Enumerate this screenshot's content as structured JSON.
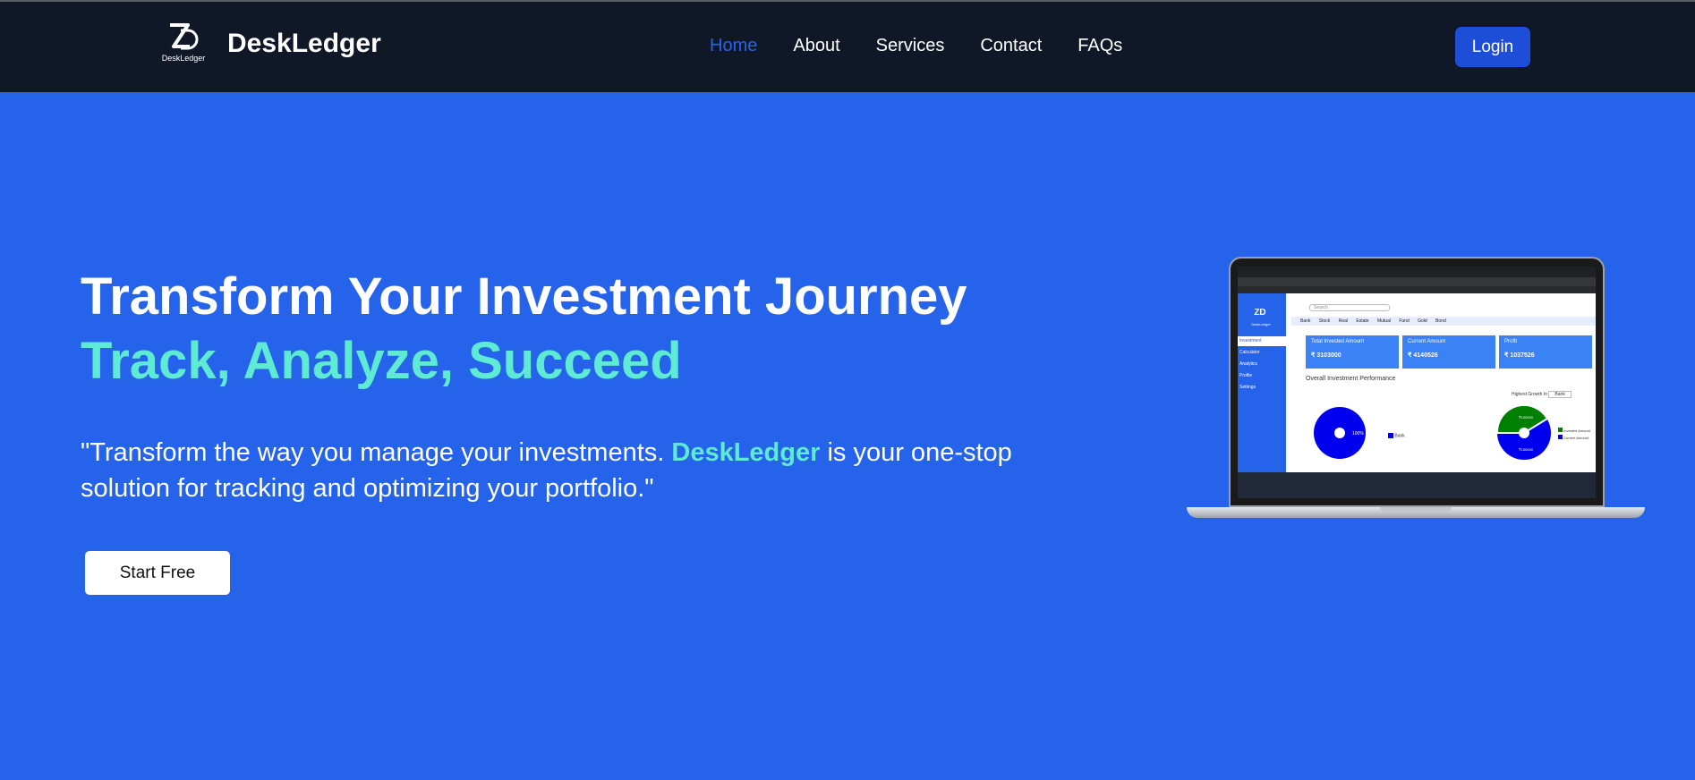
{
  "brand": {
    "name": "DeskLedger",
    "logo_caption": "DeskLedger",
    "logo_icon": "zd-monogram-icon"
  },
  "nav": {
    "items": [
      {
        "label": "Home",
        "active": true
      },
      {
        "label": "About",
        "active": false
      },
      {
        "label": "Services",
        "active": false
      },
      {
        "label": "Contact",
        "active": false
      },
      {
        "label": "FAQs",
        "active": false
      }
    ],
    "login_label": "Login"
  },
  "hero": {
    "title_line1": "Transform Your Investment Journey",
    "title_line2": "Track, Analyze, Succeed",
    "desc_before": "\"Transform the way you manage your investments. ",
    "desc_accent": "DeskLedger",
    "desc_after": " is your one-stop solution for tracking and optimizing your portfolio.\"",
    "cta_label": "Start Free"
  },
  "laptop_screen": {
    "logo_caption": "DeskLedger",
    "search_placeholder": "Search",
    "menu_items": [
      "Bank",
      "Stock",
      "Real Estate",
      "Mutual Fund",
      "Gold",
      "Bond"
    ],
    "sidebar_items": [
      "Investment",
      "Calculator",
      "Analytics",
      "Profile",
      "Settings"
    ],
    "cards": [
      {
        "label": "Total Invested Amount",
        "amount": "₹ 3103000"
      },
      {
        "label": "Current Amount",
        "amount": "₹ 4140526"
      },
      {
        "label": "Profit",
        "amount": "₹ 1037526"
      }
    ],
    "performance_title": "Overall Investment Performance",
    "growth_label": "Highest Growth In",
    "growth_select": "Bank",
    "pie1_label": "100%",
    "pie1_legend": "Bank",
    "pie2_label_top": "₹100000",
    "pie2_label_bottom": "₹150000",
    "pie2_legend": [
      "Invested Amount",
      "Current Amount"
    ]
  },
  "colors": {
    "hero_bg": "#2563eb",
    "navbar_bg": "#101828",
    "accent_teal": "#5eead4",
    "login_bg": "#1d4ed8"
  }
}
